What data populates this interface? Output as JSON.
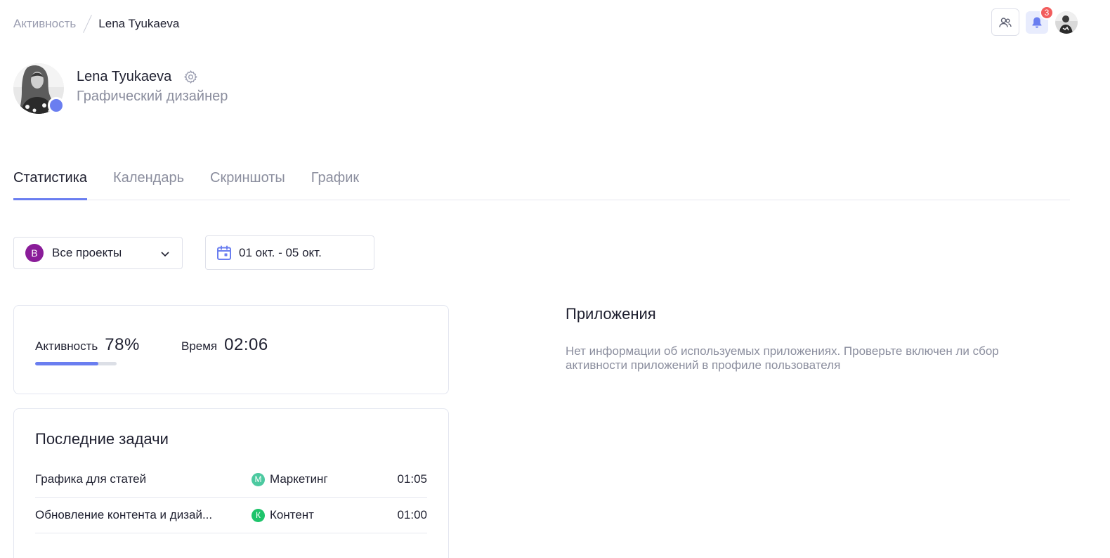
{
  "breadcrumb": {
    "parent": "Активность",
    "current": "Lena Tyukaeva"
  },
  "header": {
    "notification_count": "3"
  },
  "profile": {
    "name": "Lena Tyukaeva",
    "role": "Графический дизайнер",
    "status_color": "#6a7ef0"
  },
  "tabs": [
    {
      "label": "Статистика",
      "active": true
    },
    {
      "label": "Календарь",
      "active": false
    },
    {
      "label": "Скриншоты",
      "active": false
    },
    {
      "label": "График",
      "active": false
    }
  ],
  "filters": {
    "project": {
      "letter": "В",
      "label": "Все проекты",
      "color": "#8a1c99"
    },
    "date_range": "01 окт. - 05 окт."
  },
  "activity": {
    "label": "Активность",
    "value": "78%",
    "progress": 0.78,
    "time_label": "Время",
    "time_value": "02:06"
  },
  "tasks": {
    "title": "Последние задачи",
    "rows": [
      {
        "name": "Графика для статей",
        "project_letter": "M",
        "project": "Маркетинг",
        "project_color": "#4cc9a0",
        "time": "01:05"
      },
      {
        "name": "Обновление контента и дизай...",
        "project_letter": "К",
        "project": "Контент",
        "project_color": "#1ec46b",
        "time": "01:00"
      }
    ]
  },
  "apps": {
    "title": "Приложения",
    "message": "Нет информации об используемых приложениях. Проверьте включен ли сбор активности приложений в профиле пользователя"
  },
  "colors": {
    "accent": "#6a7ef0",
    "badge_red": "#f25c5c"
  }
}
